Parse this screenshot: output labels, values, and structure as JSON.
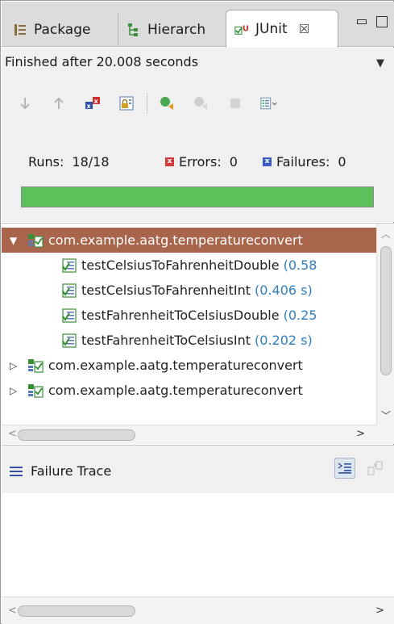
{
  "tabs": [
    {
      "label": "Package",
      "icon": "package-explorer-icon"
    },
    {
      "label": "Hierarch",
      "icon": "hierarchy-icon"
    },
    {
      "label": "JUnit",
      "icon": "junit-icon",
      "active": true,
      "close_glyph": "☒"
    }
  ],
  "status": {
    "text": "Finished after 20.008 seconds"
  },
  "toolbar": {
    "icons": [
      "next-failure-icon",
      "previous-failure-icon",
      "show-failures-only-icon",
      "scroll-lock-icon",
      "rerun-tests-icon",
      "rerun-failed-first-icon",
      "stop-icon",
      "test-run-history-icon"
    ]
  },
  "counters": {
    "runs_label": "Runs:",
    "runs_value": "18/18",
    "errors_label": "Errors:",
    "errors_value": "0",
    "failures_label": "Failures:",
    "failures_value": "0"
  },
  "progress": {
    "fraction": 1.0,
    "color": "#5cc05a"
  },
  "tree": {
    "rows": [
      {
        "kind": "suite",
        "expanded": true,
        "selected": true,
        "label": "com.example.aatg.temperatureconvert",
        "time": ""
      },
      {
        "kind": "case",
        "label": "testCelsiusToFahrenheitDouble",
        "time": "(0.58"
      },
      {
        "kind": "case",
        "label": "testCelsiusToFahrenheitInt",
        "time": "(0.406 s)"
      },
      {
        "kind": "case",
        "label": "testFahrenheitToCelsiusDouble",
        "time": "(0.25"
      },
      {
        "kind": "case",
        "label": "testFahrenheitToCelsiusInt",
        "time": "(0.202 s)"
      },
      {
        "kind": "suite",
        "expanded": false,
        "selected": false,
        "label": "com.example.aatg.temperatureconvert",
        "time": ""
      },
      {
        "kind": "suite",
        "expanded": false,
        "selected": false,
        "label": "com.example.aatg.temperatureconvert",
        "time": ""
      }
    ]
  },
  "trace": {
    "title": "Failure Trace"
  },
  "colors": {
    "selection": "#a9654b",
    "time": "#2f7fbf",
    "error": "#d23b3b",
    "failure": "#3b5cc2"
  }
}
